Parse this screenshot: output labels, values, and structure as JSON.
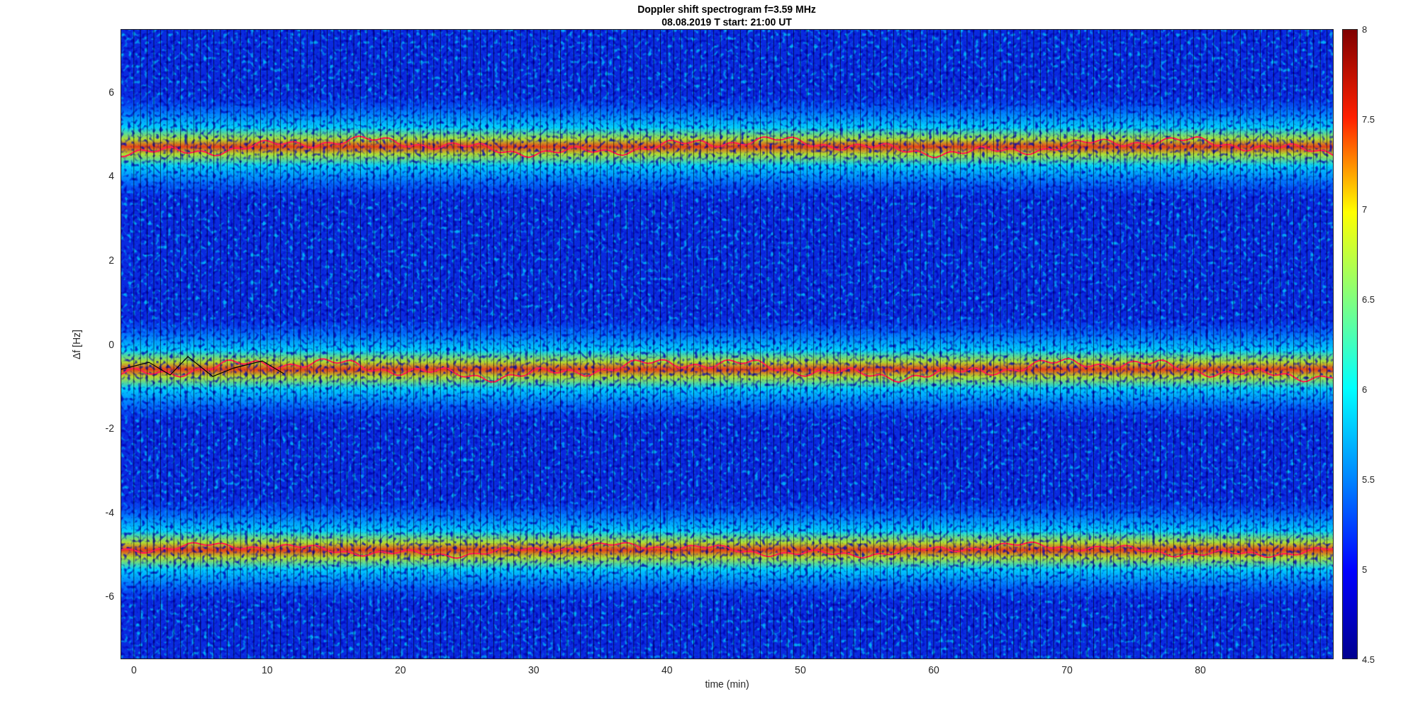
{
  "figure": {
    "title_lines": [
      "Doppler shift spectrogram f=3.59 MHz",
      "08.08.2019    T start: 21:00 UT"
    ],
    "xlabel": "time (min)",
    "ylabel": "Δf [Hz]",
    "xticks": [
      "0",
      "10",
      "20",
      "30",
      "40",
      "50",
      "60",
      "70",
      "80"
    ],
    "yticks": [
      "6",
      "4",
      "2",
      "0",
      "-2",
      "-4",
      "-6"
    ],
    "colorbar_ticks": [
      "8",
      "7.5",
      "7",
      "6.5",
      "6",
      "5.5",
      "5",
      "4.5"
    ]
  }
}
